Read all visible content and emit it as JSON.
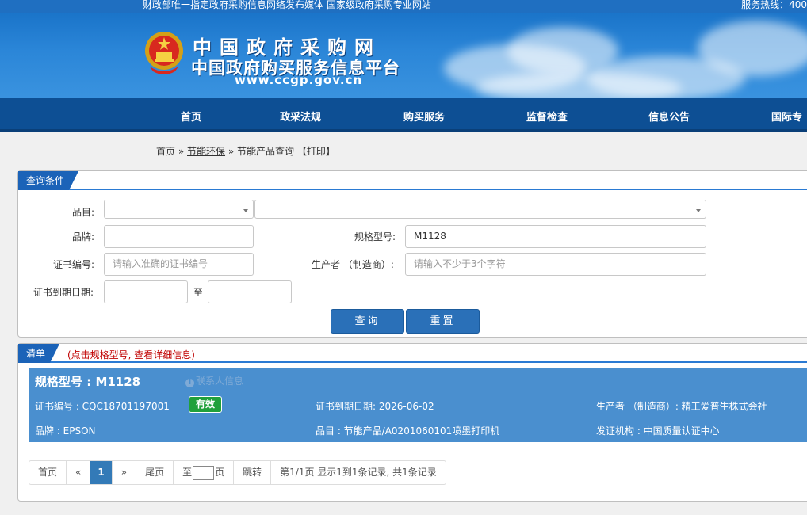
{
  "topbar": {
    "slogan": "财政部唯一指定政府采购信息网络发布媒体 国家级政府采购专业网站",
    "hotline": "服务热线：400"
  },
  "header": {
    "site_name": "中国政府采购网",
    "site_subtitle": "中国政府购买服务信息平台",
    "site_url": "www.ccgp.gov.cn",
    "emblem_icon": "national-emblem-icon"
  },
  "nav": {
    "items": [
      "首页",
      "政采法规",
      "购买服务",
      "监督检查",
      "信息公告",
      "国际专"
    ]
  },
  "breadcrumb": {
    "home": "首页",
    "sep1": "»",
    "section": "节能环保",
    "sep2": "»",
    "page": "节能产品查询",
    "print": "【打印】"
  },
  "query": {
    "title": "查询条件",
    "category_label": "品目:",
    "category_value_1": "",
    "category_value_2": "",
    "brand_label": "品牌:",
    "brand_value": "",
    "model_label": "规格型号:",
    "model_value": "M1128",
    "cert_label": "证书编号:",
    "cert_placeholder": "请输入准确的证书编号",
    "maker_label": "生产者 （制造商）:",
    "maker_placeholder": "请输入不少于3个字符",
    "expiry_label": "证书到期日期:",
    "expiry_from": "",
    "to_label": "至",
    "expiry_to": "",
    "search_button": "查询",
    "reset_button": "重置"
  },
  "list": {
    "title": "清单",
    "hint": "(点击规格型号, 查看详细信息)",
    "items": [
      {
        "model": "规格型号 : M1128",
        "contact": "联系人信息",
        "cert_no": "证书编号 : CQC18701197001",
        "status": "有效",
        "expiry": "证书到期日期: 2026-06-02",
        "maker": "生产者 （制造商）: 精工爱普生株式会社",
        "brand": "品牌 : EPSON",
        "category": "品目 : 节能产品/A0201060101喷墨打印机",
        "issuer": "发证机构 : 中国质量认证中心"
      }
    ]
  },
  "pager": {
    "first": "首页",
    "prev": "«",
    "current": "1",
    "next": "»",
    "last": "尾页",
    "goto_prefix": "至",
    "goto_suffix": "页",
    "jump": "跳转",
    "summary": "第1/1页  显示1到1条记录, 共1条记录"
  },
  "colors": {
    "nav_bg": "#0d4f94",
    "banner_bg": "#2b86d8",
    "card_bg": "#4a8fcf",
    "badge_valid": "#21a03b",
    "button_bg": "#2a70b8",
    "hint_red": "#c00000"
  }
}
